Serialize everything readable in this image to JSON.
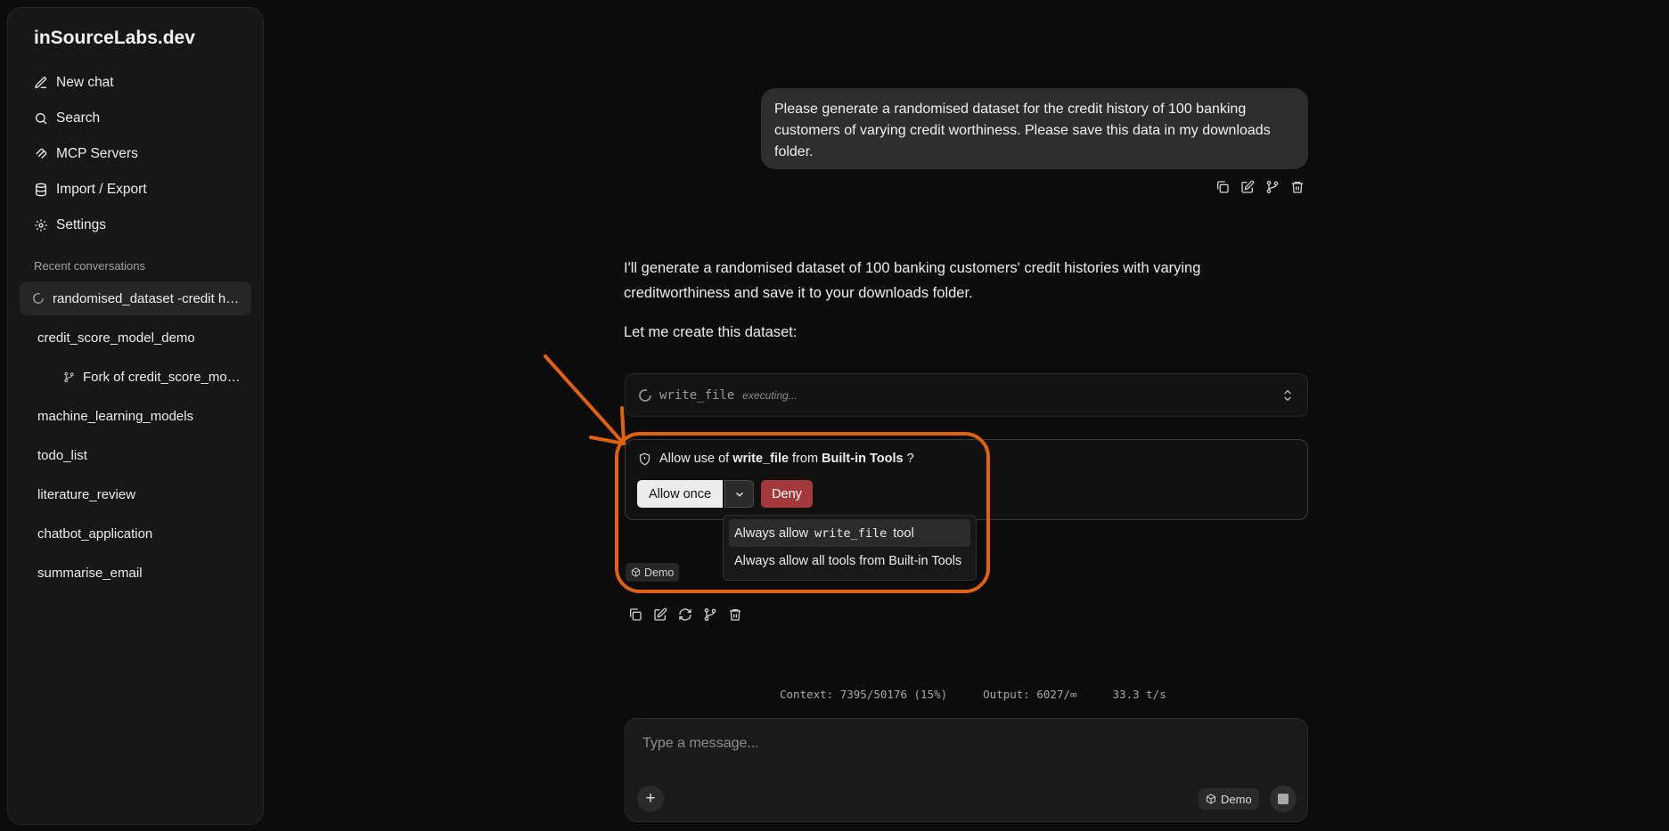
{
  "sidebar": {
    "brand": "inSourceLabs.dev",
    "nav": {
      "new_chat": "New chat",
      "search": "Search",
      "mcp_servers": "MCP Servers",
      "import_export": "Import / Export",
      "settings": "Settings"
    },
    "recent_title": "Recent conversations",
    "conversations": [
      "randomised_dataset -credit history",
      "credit_score_model_demo",
      "Fork of credit_score_model_demo",
      "machine_learning_models",
      "todo_list",
      "literature_review",
      "chatbot_application",
      "summarise_email"
    ]
  },
  "chat": {
    "user_message": "Please generate a randomised dataset for the credit history of 100 banking customers of varying credit worthiness. Please save this data in my downloads folder.",
    "assistant_intro": "I'll generate a randomised dataset of 100 banking customers' credit histories with varying creditworthiness and save it to your downloads folder.",
    "assistant_followup": "Let me create this dataset:",
    "tool": {
      "name": "write_file",
      "status": "executing..."
    },
    "permission": {
      "prefix": "Allow use of",
      "tool": "write_file",
      "middle": "from",
      "source": "Built-in Tools",
      "suffix": "?",
      "allow_once": "Allow once",
      "deny": "Deny",
      "dropdown": {
        "always_tool_prefix": "Always allow",
        "always_tool_name": "write_file",
        "always_tool_suffix": "tool",
        "always_all": "Always allow all tools from Built-in Tools"
      }
    },
    "model_badge": "Demo"
  },
  "stats": {
    "context": "Context: 7395/50176 (15%)",
    "output": "Output: 6027/∞",
    "speed": "33.3 t/s"
  },
  "composer": {
    "placeholder": "Type a message...",
    "model": "Demo"
  },
  "colors": {
    "highlight": "#e0610f",
    "deny": "#a3393b"
  }
}
